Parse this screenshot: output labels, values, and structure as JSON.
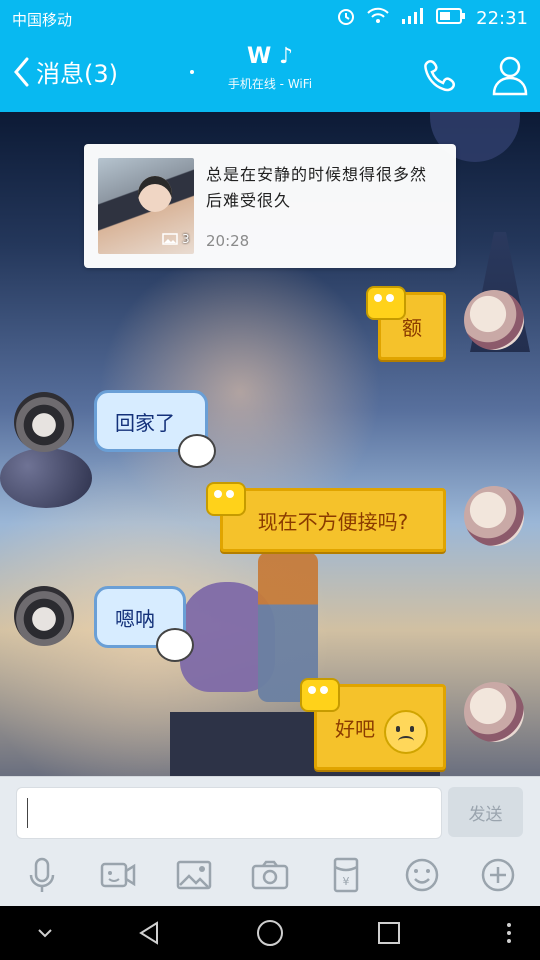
{
  "status_bar": {
    "carrier": "中国移动",
    "time": "22:31"
  },
  "header": {
    "back_label": "消息(3)",
    "title": "W ♪",
    "subtitle": "手机在线 - WiFi"
  },
  "messages": [
    {
      "type": "share_card",
      "side": "right",
      "text": "总是在安静的时候想得很多然后难受很久",
      "time": "20:28",
      "image_count": "3"
    },
    {
      "type": "bubble",
      "side": "right",
      "text": "额"
    },
    {
      "type": "bubble",
      "side": "left",
      "text": "回家了"
    },
    {
      "type": "bubble",
      "side": "right",
      "text": "现在不方便接吗?"
    },
    {
      "type": "bubble",
      "side": "left",
      "text": "嗯呐"
    },
    {
      "type": "bubble",
      "side": "right",
      "text": "好吧"
    }
  ],
  "composer": {
    "input_value": "",
    "send_label": "发送"
  },
  "tool_icons": [
    "mic-icon",
    "video-icon",
    "image-icon",
    "camera-icon",
    "red-packet-icon",
    "emoji-icon",
    "plus-icon"
  ],
  "colors": {
    "header_bg": "#08b9f1",
    "bubble_yellow": "#f5c22b",
    "bubble_blue": "#d7ecff"
  }
}
